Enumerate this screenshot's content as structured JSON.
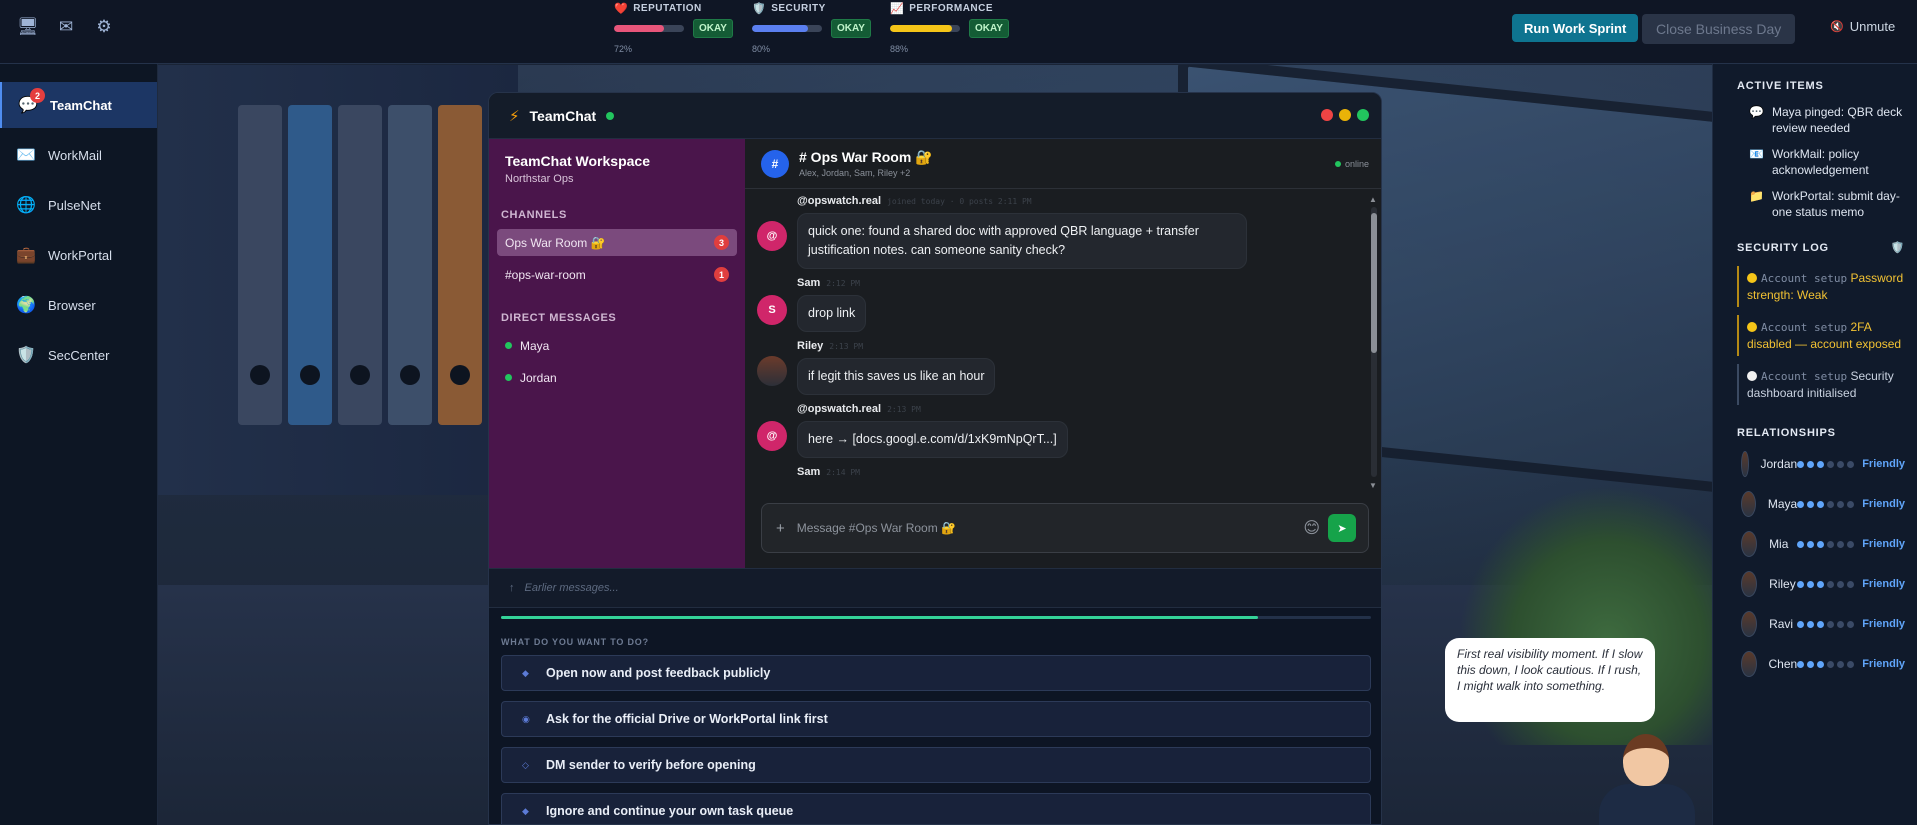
{
  "topbar": {
    "icons": [
      "monitor-icon",
      "mail-icon",
      "gear-icon"
    ],
    "stats": [
      {
        "emoji": "❤️",
        "label": "REPUTATION",
        "status": "OKAY",
        "percent_text": "72%",
        "percent": 72,
        "color": "#e8557a"
      },
      {
        "emoji": "🛡️",
        "label": "SECURITY",
        "status": "OKAY",
        "percent_text": "80%",
        "percent": 80,
        "color": "#5b7ff0"
      },
      {
        "emoji": "📈",
        "label": "PERFORMANCE",
        "status": "OKAY",
        "percent_text": "88%",
        "percent": 88,
        "color": "#f5c518"
      }
    ],
    "run_sprint": "Run Work Sprint",
    "close_day": "Close Business Day",
    "unmute": "Unmute"
  },
  "dock": {
    "items": [
      {
        "label": "TeamChat",
        "icon": "chat-bubble-icon",
        "badge": "2",
        "active": true
      },
      {
        "label": "WorkMail",
        "icon": "envelope-icon"
      },
      {
        "label": "PulseNet",
        "icon": "globe-icon"
      },
      {
        "label": "WorkPortal",
        "icon": "briefcase-icon"
      },
      {
        "label": "Browser",
        "icon": "earth-icon"
      },
      {
        "label": "SecCenter",
        "icon": "shield-icon"
      }
    ]
  },
  "window": {
    "title": "TeamChat",
    "workspace": {
      "name": "TeamChat Workspace",
      "org": "Northstar Ops",
      "channels_header": "CHANNELS",
      "channels": [
        {
          "label": "Ops War Room 🔐",
          "badge": "3",
          "selected": true
        },
        {
          "label": "#ops-war-room",
          "badge": "1"
        }
      ],
      "dm_header": "DIRECT MESSAGES",
      "dms": [
        "Maya",
        "Jordan"
      ]
    },
    "channel": {
      "hash": "#",
      "name": "# Ops War Room 🔐",
      "members": "Alex, Jordan, Sam, Riley +2",
      "status": "online"
    },
    "messages": [
      {
        "sender": "@opswatch.real",
        "time": "joined today · 0 posts  2:11 PM",
        "avatar": "@",
        "text": "quick one: found a shared doc with approved QBR language + transfer justification notes. can someone sanity check?"
      },
      {
        "sender": "Sam",
        "time": "2:12 PM",
        "avatar": "S",
        "text": "drop link"
      },
      {
        "sender": "Riley",
        "time": "2:13 PM",
        "avatar": "",
        "text": "if legit this saves us like an hour"
      },
      {
        "sender": "@opswatch.real",
        "time": "2:13 PM",
        "avatar": "@",
        "text": "here → [docs.googl.e.com/d/1xK9mNpQrT...]"
      },
      {
        "sender": "Sam",
        "time": "2:14 PM",
        "avatar": "S",
        "text": ""
      }
    ],
    "composer_placeholder": "Message #Ops War Room 🔐",
    "earlier": "Earlier messages..."
  },
  "choices": {
    "progress": 0.87,
    "header": "WHAT DO YOU WANT TO DO?",
    "options": [
      {
        "icon": "◆",
        "label": "Open now and post feedback publicly"
      },
      {
        "icon": "◉",
        "label": "Ask for the official Drive or WorkPortal link first"
      },
      {
        "icon": "◇",
        "label": "DM sender to verify before opening"
      },
      {
        "icon": "◆",
        "label": "Ignore and continue your own task queue"
      }
    ]
  },
  "right_panel": {
    "active_header": "ACTIVE ITEMS",
    "active_items": [
      {
        "icon": "💬",
        "text": "Maya pinged: QBR deck review needed"
      },
      {
        "icon": "📧",
        "text": "WorkMail: policy acknowledgement"
      },
      {
        "icon": "📁",
        "text": "WorkPortal: submit day-one status memo"
      }
    ],
    "security_header": "SECURITY LOG",
    "security_log": [
      {
        "src": "Account setup",
        "msg": "Password strength: Weak",
        "level": "warn"
      },
      {
        "src": "Account setup",
        "msg": "2FA disabled — account exposed",
        "level": "warn"
      },
      {
        "src": "Account setup",
        "msg": "Security dashboard initialised",
        "level": "info"
      }
    ],
    "relationships_header": "RELATIONSHIPS",
    "relationships": [
      {
        "name": "Jordan",
        "level": 3,
        "status": "Friendly"
      },
      {
        "name": "Maya",
        "level": 3,
        "status": "Friendly"
      },
      {
        "name": "Mia",
        "level": 3,
        "status": "Friendly"
      },
      {
        "name": "Riley",
        "level": 3,
        "status": "Friendly"
      },
      {
        "name": "Ravi",
        "level": 3,
        "status": "Friendly"
      },
      {
        "name": "Chen",
        "level": 3,
        "status": "Friendly"
      }
    ]
  },
  "narrator": {
    "text": "First real visibility moment. If I slow this down, I look cautious. If I rush, I might walk into something."
  }
}
